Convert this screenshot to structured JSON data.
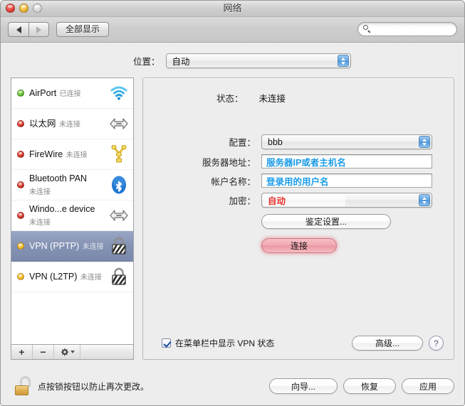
{
  "window": {
    "title": "网络",
    "traffic_lights": [
      "close",
      "minimize",
      "zoom"
    ]
  },
  "toolbar": {
    "back_icon": "triangle-left-icon",
    "forward_icon": "triangle-right-icon",
    "show_all_label": "全部显示",
    "search_placeholder": "",
    "search_value": "",
    "search_icon": "magnifier-icon"
  },
  "location": {
    "label": "位置：",
    "value": "自动"
  },
  "sidebar": {
    "services": [
      {
        "name": "AirPort",
        "state": "已连接",
        "dot": "green",
        "icon": "wifi-icon",
        "selected": false
      },
      {
        "name": "以太网",
        "state": "未连接",
        "dot": "red",
        "icon": "ethernet-icon",
        "selected": false
      },
      {
        "name": "FireWire",
        "state": "未连接",
        "dot": "red",
        "icon": "firewire-icon",
        "selected": false
      },
      {
        "name": "Bluetooth PAN",
        "state": "未连接",
        "dot": "red",
        "icon": "bluetooth-icon",
        "selected": false
      },
      {
        "name": "Windo...e device",
        "state": "未连接",
        "dot": "red",
        "icon": "ethernet-icon",
        "selected": false
      },
      {
        "name": "VPN (PPTP)",
        "state": "未连接",
        "dot": "yellow",
        "icon": "vpn-lock-icon",
        "selected": true
      },
      {
        "name": "VPN (L2TP)",
        "state": "未连接",
        "dot": "yellow",
        "icon": "vpn-lock-icon",
        "selected": false
      }
    ],
    "toolbar": {
      "add_label": "+",
      "remove_label": "−",
      "gear_label": "gear-icon"
    }
  },
  "main": {
    "status": {
      "label": "状态：",
      "value": "未连接"
    },
    "fields": {
      "config": {
        "label": "配置：",
        "value": "bbb"
      },
      "server": {
        "label": "服务器地址：",
        "placeholder": "服务器IP或者主机名",
        "value": ""
      },
      "account": {
        "label": "帐户名称：",
        "placeholder": "登录用的用户名",
        "value": ""
      },
      "encryption": {
        "label": "加密：",
        "value": "自动"
      }
    },
    "auth_button": "鉴定设置...",
    "connect_button": "连接",
    "show_vpn_status": {
      "label": "在菜单栏中显示 VPN 状态",
      "checked": true
    },
    "advanced_button": "高级...",
    "help_button": "?"
  },
  "footer": {
    "lock_icon": "unlocked-padlock-icon",
    "lock_text": "点按锁按钮以防止再次更改。",
    "buttons": {
      "assistant": "向导...",
      "revert": "恢复",
      "apply": "应用"
    }
  },
  "colors": {
    "accent_blue": "#1a9ce8",
    "encryption_red": "#e8322b",
    "selection_blue": "#8492b3",
    "connect_pink": "#f0a8b1",
    "status_green": "#5fba2c",
    "status_red": "#d23327",
    "status_yellow": "#f5b81f"
  }
}
